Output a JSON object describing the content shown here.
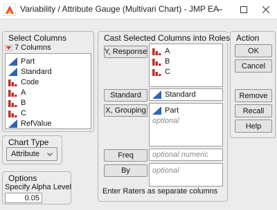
{
  "window": {
    "title": "Variability / Attribute Gauge (Multivari Chart) - JMP EA",
    "app_icon": "jmp-app-icon",
    "minimize_icon": "minimize-icon",
    "maximize_icon": "maximize-icon",
    "close_icon": "close-icon"
  },
  "select_columns": {
    "title": "Select Columns",
    "count_label": "7 Columns",
    "columns": [
      {
        "label": "Part",
        "icon": "continuous-icon"
      },
      {
        "label": "Standard",
        "icon": "continuous-icon"
      },
      {
        "label": "Code",
        "icon": "nominal-icon"
      },
      {
        "label": "A",
        "icon": "nominal-icon"
      },
      {
        "label": "B",
        "icon": "nominal-icon"
      },
      {
        "label": "C",
        "icon": "nominal-icon"
      },
      {
        "label": "RefValue",
        "icon": "continuous-icon"
      }
    ]
  },
  "chart_type": {
    "title": "Chart Type",
    "selected": "Attribute"
  },
  "options": {
    "title": "Options",
    "alpha_label": "Specify Alpha Level",
    "alpha_value": "0.05"
  },
  "cast": {
    "title": "Cast Selected Columns into Roles",
    "y_response": {
      "label": "Y, Response",
      "items": [
        "A",
        "B",
        "C"
      ]
    },
    "standard": {
      "label": "Standard",
      "value": "Standard"
    },
    "x_grouping": {
      "label": "X, Grouping",
      "items": [
        "Part"
      ],
      "placeholder": "optional"
    },
    "freq": {
      "label": "Freq",
      "placeholder": "optional numeric"
    },
    "by": {
      "label": "By",
      "placeholder": "optional"
    },
    "note": "Enter Raters as separate columns"
  },
  "action": {
    "title": "Action",
    "ok": "OK",
    "cancel": "Cancel",
    "remove": "Remove",
    "recall": "Recall",
    "help": "Help"
  },
  "colors": {
    "nominal": "#c0302a",
    "continuous": "#2e63b8",
    "accent_red": "#d9302c"
  }
}
